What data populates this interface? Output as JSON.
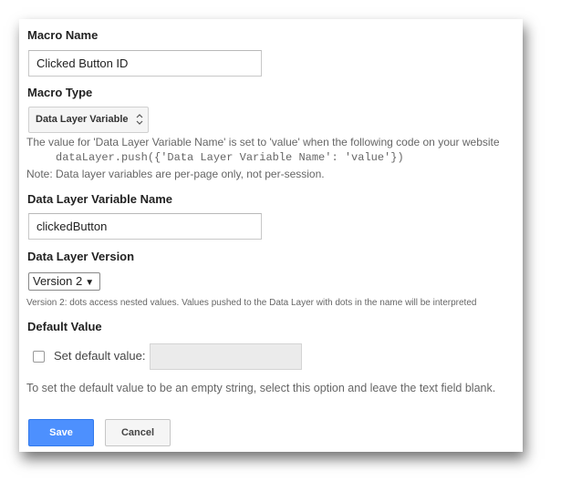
{
  "macro_name": {
    "label": "Macro Name",
    "value": "Clicked Button ID"
  },
  "macro_type": {
    "label": "Macro Type",
    "selected": "Data Layer Variable",
    "description": "The value for 'Data Layer Variable Name' is set to 'value' when the following code on your website",
    "code": "dataLayer.push({'Data Layer Variable Name': 'value'})",
    "note": "Note: Data layer variables are per-page only, not per-session."
  },
  "dlv_name": {
    "label": "Data Layer Variable Name",
    "value": "clickedButton"
  },
  "dl_version": {
    "label": "Data Layer Version",
    "selected": "Version 2",
    "description": "Version 2: dots access nested values. Values pushed to the Data Layer with dots in the name will be interpreted"
  },
  "default_value": {
    "label": "Default Value",
    "checkbox_label": "Set default value:",
    "checked": false,
    "hint": "To set the default value to be an empty string, select this option and leave the text field blank."
  },
  "buttons": {
    "save": "Save",
    "cancel": "Cancel"
  },
  "colors": {
    "primary": "#4d90fe",
    "heading": "#222222",
    "muted": "#666666"
  }
}
